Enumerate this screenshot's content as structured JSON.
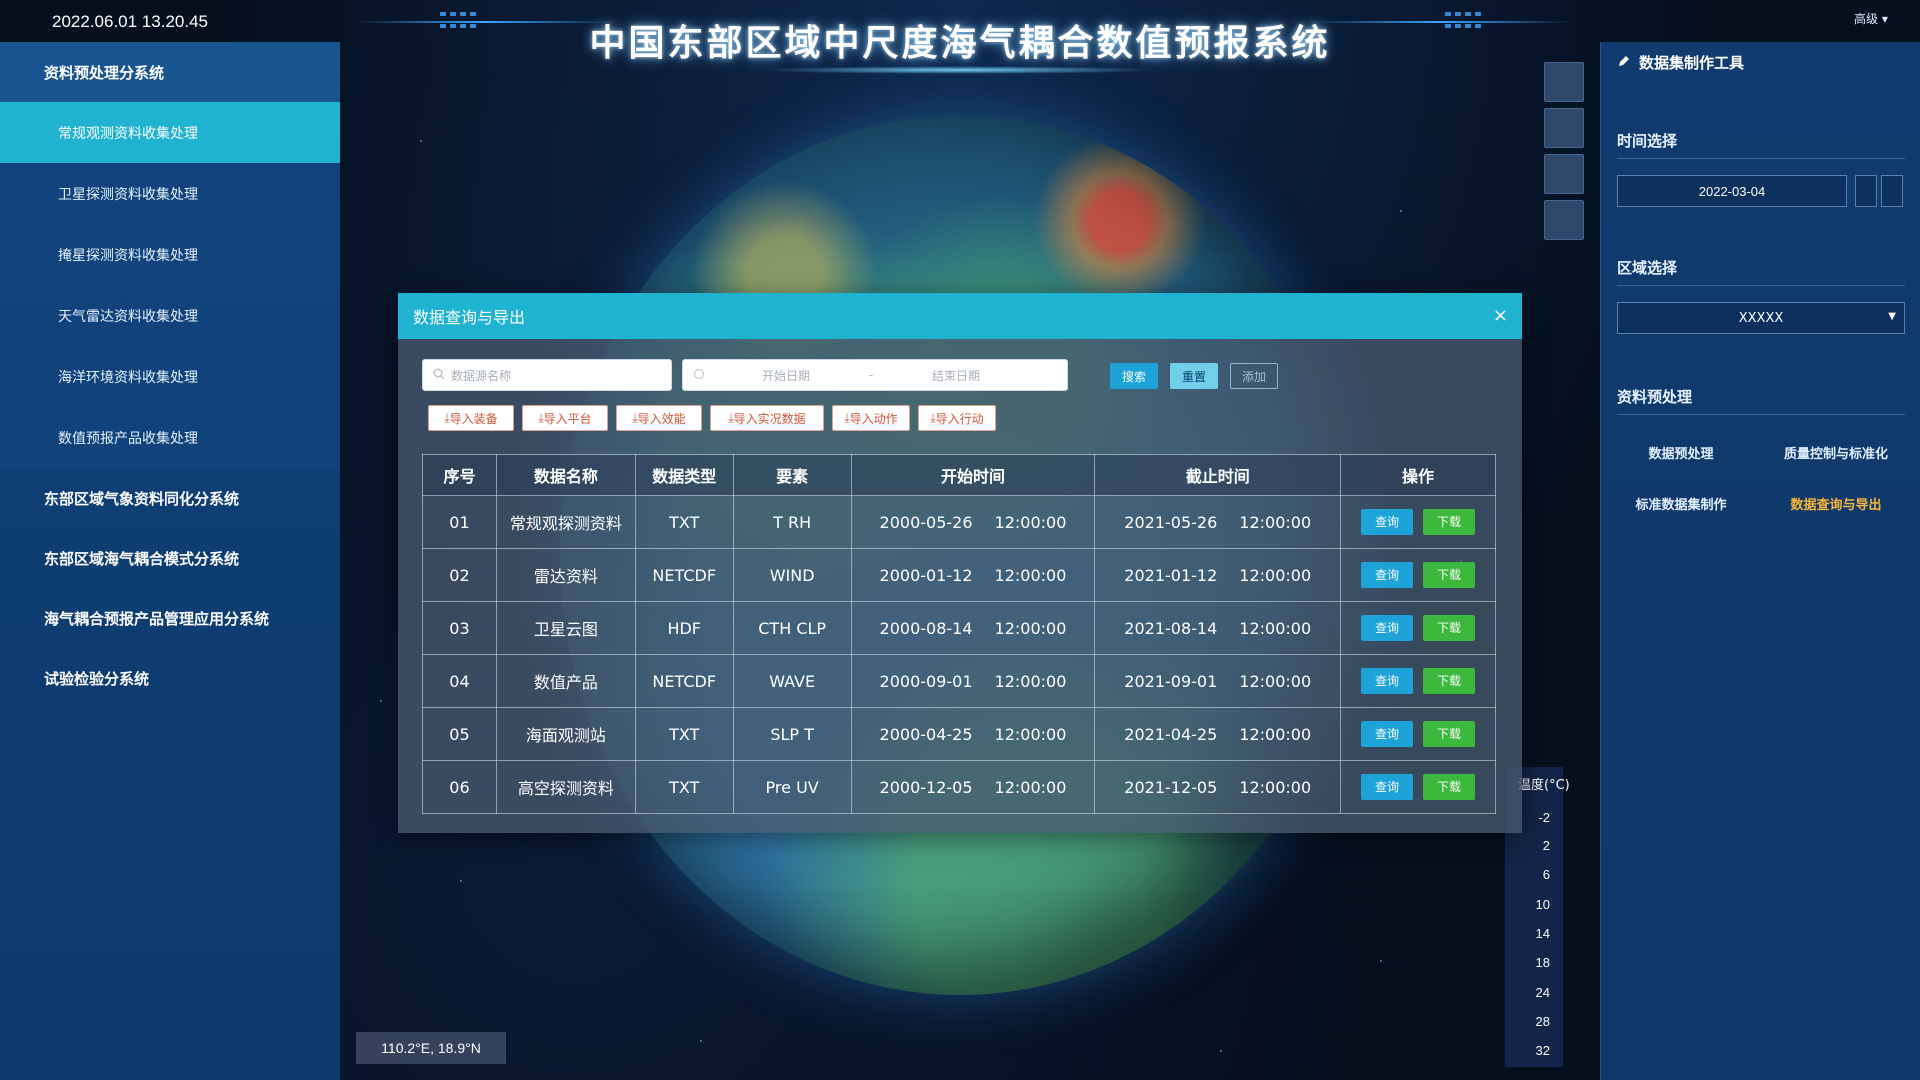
{
  "header": {
    "datetime": "2022.06.01 13.20.45",
    "title": "中国东部区域中尺度海气耦合数值预报系统",
    "user_menu": "高级 ▾"
  },
  "left_sidebar": {
    "group1": "资料预处理分系统",
    "sub_items": [
      "常规观测资料收集处理",
      "卫星探测资料收集处理",
      "掩星探测资料收集处理",
      "天气雷达资料收集处理",
      "海洋环境资料收集处理",
      "数值预报产品收集处理"
    ],
    "groups": [
      "东部区域气象资料同化分系统",
      "东部区域海气耦合模式分系统",
      "海气耦合预报产品管理应用分系统",
      "试验检验分系统"
    ]
  },
  "right_panel": {
    "title": "数据集制作工具",
    "time_label": "时间选择",
    "date_value": "2022-03-04",
    "region_label": "区域选择",
    "region_value": "XXXXX",
    "preprocess_label": "资料预处理",
    "links": [
      "数据预处理",
      "质量控制与标准化",
      "标准数据集制作",
      "数据查询与导出"
    ]
  },
  "legend": {
    "title": "温度(°C)",
    "values": [
      "-2",
      "2",
      "6",
      "10",
      "14",
      "18",
      "24",
      "28",
      "32"
    ]
  },
  "coords": "110.2°E, 18.9°N",
  "modal": {
    "title": "数据查询与导出",
    "close": "×",
    "search_placeholder": "数据源名称",
    "start_placeholder": "开始日期",
    "range_sep": "-",
    "end_placeholder": "结束日期",
    "search_btn": "搜索",
    "reset_btn": "重置",
    "add_btn": "添加",
    "import_buttons": [
      "导入装备",
      "导入平台",
      "导入效能",
      "导入实况数据",
      "导入动作",
      "导入行动"
    ],
    "table": {
      "headers": [
        "序号",
        "数据名称",
        "数据类型",
        "要素",
        "开始时间",
        "截止时间",
        "操作"
      ],
      "query_label": "查询",
      "download_label": "下载",
      "rows": [
        {
          "no": "01",
          "name": "常规观探测资料",
          "type": "TXT",
          "elem": "T RH",
          "start_date": "2000-05-26",
          "start_time": "12:00:00",
          "end_date": "2021-05-26",
          "end_time": "12:00:00"
        },
        {
          "no": "02",
          "name": "雷达资料",
          "type": "NETCDF",
          "elem": "WIND",
          "start_date": "2000-01-12",
          "start_time": "12:00:00",
          "end_date": "2021-01-12",
          "end_time": "12:00:00"
        },
        {
          "no": "03",
          "name": "卫星云图",
          "type": "HDF",
          "elem": "CTH CLP",
          "start_date": "2000-08-14",
          "start_time": "12:00:00",
          "end_date": "2021-08-14",
          "end_time": "12:00:00"
        },
        {
          "no": "04",
          "name": "数值产品",
          "type": "NETCDF",
          "elem": "WAVE",
          "start_date": "2000-09-01",
          "start_time": "12:00:00",
          "end_date": "2021-09-01",
          "end_time": "12:00:00"
        },
        {
          "no": "05",
          "name": "海面观测站",
          "type": "TXT",
          "elem": "SLP T",
          "start_date": "2000-04-25",
          "start_time": "12:00:00",
          "end_date": "2021-04-25",
          "end_time": "12:00:00"
        },
        {
          "no": "06",
          "name": "高空探测资料",
          "type": "TXT",
          "elem": "Pre UV",
          "start_date": "2000-12-05",
          "start_time": "12:00:00",
          "end_date": "2021-12-05",
          "end_time": "12:00:00"
        }
      ]
    }
  }
}
